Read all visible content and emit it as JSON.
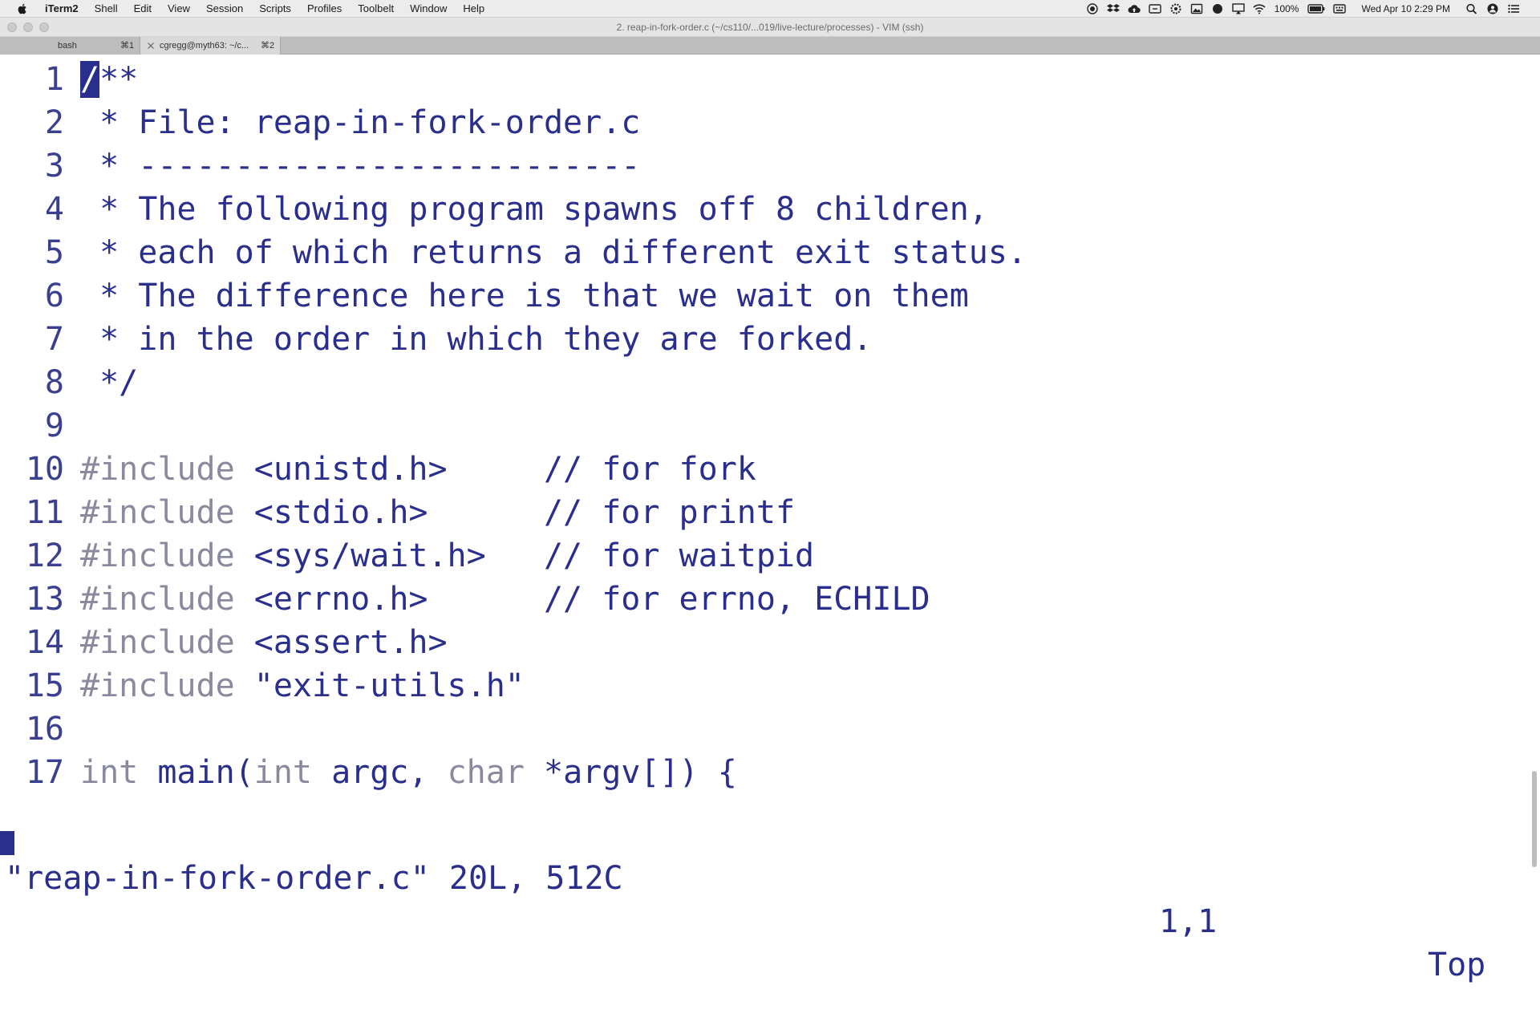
{
  "menubar": {
    "app_name": "iTerm2",
    "items": [
      "Shell",
      "Edit",
      "View",
      "Session",
      "Scripts",
      "Profiles",
      "Toolbelt",
      "Window",
      "Help"
    ],
    "battery": "100%",
    "datetime": "Wed Apr 10  2:29 PM"
  },
  "window": {
    "title": "2. reap-in-fork-order.c (~/cs110/...019/live-lecture/processes) - VIM (ssh)"
  },
  "tabs": [
    {
      "title": "bash",
      "shortcut": "⌘1"
    },
    {
      "title": "cgregg@myth63: ~/c...",
      "shortcut": "⌘2"
    }
  ],
  "editor": {
    "lines": [
      {
        "n": "1",
        "segs": [
          {
            "t": "/",
            "c": "cursor"
          },
          {
            "t": "**",
            "c": ""
          }
        ]
      },
      {
        "n": "2",
        "segs": [
          {
            "t": " * File: reap-in-fork-order.c",
            "c": ""
          }
        ]
      },
      {
        "n": "3",
        "segs": [
          {
            "t": " * --------------------------",
            "c": ""
          }
        ]
      },
      {
        "n": "4",
        "segs": [
          {
            "t": " * The following program spawns off 8 children,",
            "c": ""
          }
        ]
      },
      {
        "n": "5",
        "segs": [
          {
            "t": " * each of which returns a different exit status.",
            "c": ""
          }
        ]
      },
      {
        "n": "6",
        "segs": [
          {
            "t": " * The difference here is that we wait on them",
            "c": ""
          }
        ]
      },
      {
        "n": "7",
        "segs": [
          {
            "t": " * in the order in which they are forked.",
            "c": ""
          }
        ]
      },
      {
        "n": "8",
        "segs": [
          {
            "t": " */",
            "c": ""
          }
        ]
      },
      {
        "n": "9",
        "segs": [
          {
            "t": "",
            "c": ""
          }
        ]
      },
      {
        "n": "10",
        "segs": [
          {
            "t": "#include",
            "c": "kw"
          },
          {
            "t": " <unistd.h>     // for fork",
            "c": ""
          }
        ]
      },
      {
        "n": "11",
        "segs": [
          {
            "t": "#include",
            "c": "kw"
          },
          {
            "t": " <stdio.h>      // for printf",
            "c": ""
          }
        ]
      },
      {
        "n": "12",
        "segs": [
          {
            "t": "#include",
            "c": "kw"
          },
          {
            "t": " <sys/wait.h>   // for waitpid",
            "c": ""
          }
        ]
      },
      {
        "n": "13",
        "segs": [
          {
            "t": "#include",
            "c": "kw"
          },
          {
            "t": " <errno.h>      // for errno, ECHILD",
            "c": ""
          }
        ]
      },
      {
        "n": "14",
        "segs": [
          {
            "t": "#include",
            "c": "kw"
          },
          {
            "t": " <assert.h>",
            "c": ""
          }
        ]
      },
      {
        "n": "15",
        "segs": [
          {
            "t": "#include",
            "c": "kw"
          },
          {
            "t": " \"exit-utils.h\"",
            "c": ""
          }
        ]
      },
      {
        "n": "16",
        "segs": [
          {
            "t": "",
            "c": ""
          }
        ]
      },
      {
        "n": "17",
        "segs": [
          {
            "t": "int",
            "c": "kw"
          },
          {
            "t": " main(",
            "c": ""
          },
          {
            "t": "int",
            "c": "kw"
          },
          {
            "t": " argc, ",
            "c": ""
          },
          {
            "t": "char",
            "c": "kw"
          },
          {
            "t": " *argv[]) {",
            "c": ""
          }
        ]
      }
    ],
    "status_message": "\"reap-in-fork-order.c\" 20L, 512C",
    "cursor_position": "1,1",
    "scroll_position": "Top"
  },
  "colors": {
    "code_text": "#2a2e8c",
    "keyword": "#8a8a9e",
    "cursor": "#2a2e8c"
  }
}
